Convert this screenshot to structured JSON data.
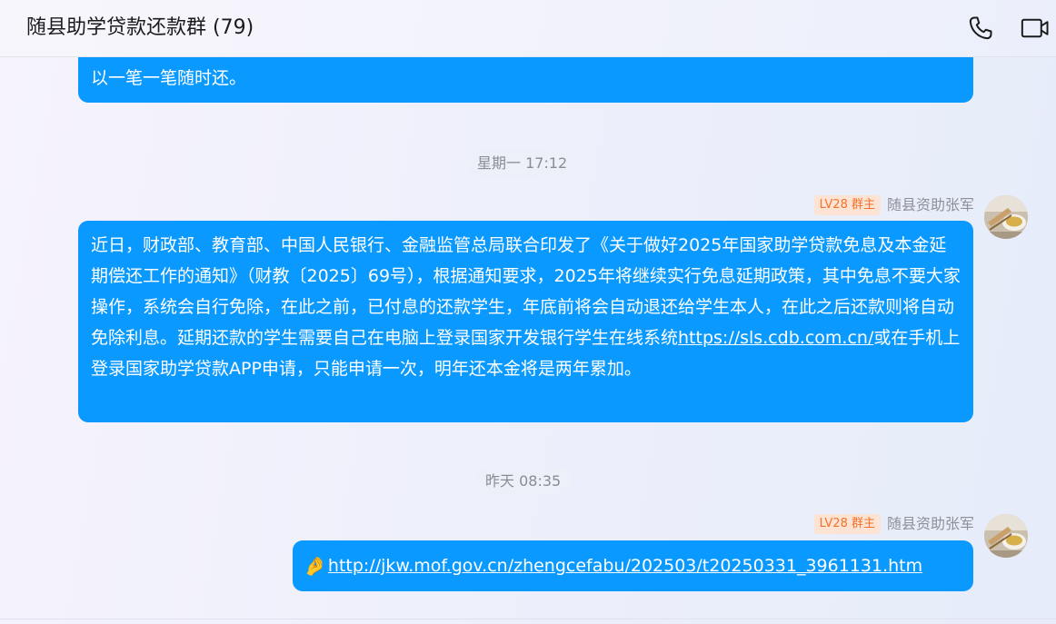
{
  "header": {
    "title": "随县助学贷款还款群 (79)",
    "call_icon": "phone-icon",
    "video_icon": "video-camera-icon"
  },
  "messages": {
    "top_fragment": "以一笔一笔随时还。",
    "time1": "星期一 17:12",
    "msg1": {
      "badge": "LV28 群主",
      "sender": "随县资助张军",
      "text_before": "近日，财政部、教育部、中国人民银行、金融监管总局联合印发了《关于做好2025年国家助学贷款免息及本金延期偿还工作的通知》（财教〔2025〕69号），根据通知要求，2025年将继续实行免息延期政策，其中免息不要大家操作，系统会自行免除，在此之前，已付息的还款学生，年底前将会自动退还给学生本人，在此之后还款则将自动免除利息。延期还款的学生需要自己在电脑上登录国家开发银行学生在线系统",
      "link": "https://sls.cdb.com.cn/",
      "text_after": "或在手机上登录国家助学贷款APP申请，只能申请一次，明年还本金将是两年累加。"
    },
    "time2": "昨天 08:35",
    "msg2": {
      "badge": "LV28 群主",
      "sender": "随县资助张军",
      "emoji": "🤌",
      "link": "http://jkw.mof.gov.cn/zhengcefabu/202503/t20250331_3961131.htm"
    }
  },
  "colors": {
    "bubble": "#0a99ff",
    "badge_text": "#f4722b",
    "badge_bg": "#fde3d3"
  }
}
